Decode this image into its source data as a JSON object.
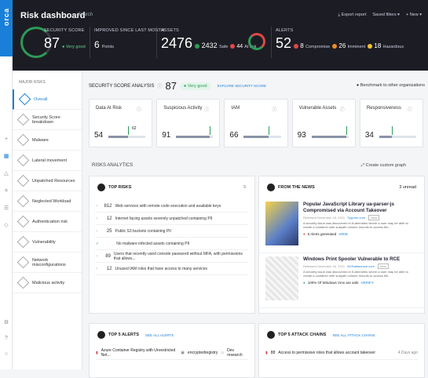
{
  "brand": "orca",
  "header": {
    "title": "Risk dashboard",
    "search": "Search",
    "export": "Export report",
    "saved": "Saved filters",
    "new": "+ New"
  },
  "score": {
    "label": "SECURITY SCORE",
    "value": "87",
    "status": "Very good"
  },
  "improved": {
    "label": "IMPROVED SINCE LAST MONTH",
    "value": "6",
    "unit": "Points"
  },
  "assets": {
    "label": "ASSETS",
    "value": "2476",
    "safe": "2432",
    "safe_lbl": "Safe",
    "risk": "44",
    "risk_lbl": "At risk"
  },
  "alerts": {
    "label": "ALERTS",
    "value": "52",
    "compromise": "8",
    "compromise_lbl": "Compromise",
    "imminent": "26",
    "imminent_lbl": "Imminent",
    "hazardous": "18",
    "hazardous_lbl": "Hazardous"
  },
  "sidebar": {
    "heading": "MAJOR RISKS",
    "items": [
      "Overall",
      "Security Score breakdown",
      "Malware",
      "Lateral movement",
      "Unpatched Resources",
      "Neglected Workload",
      "Authentication risk",
      "Vulnerability",
      "Network misconfigurations",
      "Malicious activity"
    ]
  },
  "analysis": {
    "title": "SECURITY SCORE ANALYSIS",
    "value": "87",
    "status": "Very good",
    "explore": "EXPLORE SECURITY SCORE",
    "benchmark": "Benchmark to other organizations"
  },
  "cards": [
    {
      "label": "Data At Risk",
      "value": "54",
      "fill": 0.54,
      "marker": "62"
    },
    {
      "label": "Suspicious Activity",
      "value": "91",
      "fill": 0.91
    },
    {
      "label": "IAM",
      "value": "66",
      "fill": 0.66
    },
    {
      "label": "Vulnerable Assets",
      "value": "93",
      "fill": 0.93
    },
    {
      "label": "Responsiveness",
      "value": "34",
      "fill": 0.34
    }
  ],
  "risk_analytics": {
    "title": "RISKS ANALYTICS",
    "create": "Create custom graph"
  },
  "top_risks": {
    "title": "TOP RISKS",
    "rows": [
      {
        "n": "812",
        "t": "Web services with remote code execution and available keys"
      },
      {
        "n": "12",
        "t": "Internet facing assets severely unpatched containing PII"
      },
      {
        "n": "25",
        "t": "Public S3 buckets containing PII"
      },
      {
        "n": "",
        "t": "No malware infected assets containing PII"
      },
      {
        "n": "89",
        "t": "Users that recently used console password without MFA, with permissions that allows..."
      },
      {
        "n": "12",
        "t": "Unused IAM roles that have access to many services"
      }
    ]
  },
  "news": {
    "title": "FROM THE NEWS",
    "unread": "3 unread",
    "items": [
      {
        "title": "Popular JavaScript Library ua-parser-js Compromised via Account Takeover",
        "date": "Released December 16, 2021",
        "src": "Tyypron.com",
        "desc": "A security issue was discovered in Kubernetes where a user may be able to create a container with subpath volume mounts to access file...",
        "badge": "5 Alerts generated",
        "link": "VIEW",
        "tag": "New"
      },
      {
        "title": "Windows Print Spooler Vulnerable to RCE",
        "date": "Released December 16, 2021",
        "src": "NVDatasource.com",
        "desc": "A security issue was discovered in Kubernetes where a user may be able to create a container with subpath volume mounts to access file...",
        "badge": "100% Of Windows Vms are safe",
        "link": "VERIFY",
        "tag": "New"
      }
    ]
  },
  "top_alerts": {
    "title": "TOP 5 ALERTS",
    "link": "SEE ALL ALERTS",
    "row": "Azure Container Registry with Unrestricted Net...",
    "tag": "encryptedregistry",
    "env": "Dev research"
  },
  "attack_chains": {
    "title": "TOP 5 ATTACK CHAINS",
    "link": "SEE ALL ATTACK CHAINS",
    "n": "88",
    "row": "Access to permissive roles that allows account takeover",
    "time": "4 Days ago"
  }
}
